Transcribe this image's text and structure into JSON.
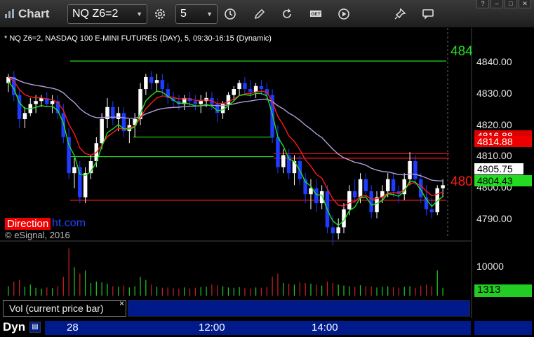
{
  "window": {
    "title": "Chart",
    "symbol": "NQ Z6=2",
    "interval": "5",
    "window_controls": [
      "?",
      "–",
      "□",
      "✕"
    ]
  },
  "toolbar": {
    "buttons": [
      "settings-gear",
      "interval-clock",
      "draw-pencil",
      "refresh",
      "get",
      "play",
      "pin",
      "comment"
    ],
    "get_label": "GET"
  },
  "chart": {
    "description": "* NQ Z6=2, NASDAQ 100 E-MINI FUTURES (DAY), 5, 09:30-16:15 (Dynamic)",
    "watermark_a": "Direction",
    "watermark_b": "ht.com",
    "copyright": "© eSignal, 2016",
    "price_ticks": [
      "4840.00",
      "4830.00",
      "4820.00",
      "4810.00",
      "4800.00",
      "4790.00"
    ],
    "side_labels": {
      "top_green": "484",
      "bottom_red": "480"
    },
    "tags": {
      "red_a": "4816.88",
      "red_b": "4814.88",
      "last": "4805.75",
      "green_hidden": "4804.43"
    },
    "volume_ticks": [
      "10000"
    ],
    "volume_last": "1313",
    "volume_label": "Vol (current price bar)",
    "volume_close": "×",
    "time_labels": [
      "28",
      "12:00",
      "14:00"
    ],
    "dyn_label": "Dyn"
  },
  "colors": {
    "up": "#ffffff",
    "down": "#1d3cff",
    "green_line": "#22dd22",
    "red_line": "#ff1a1a",
    "purple_line": "#b39ddb",
    "vol_green": "#22cc22",
    "vol_red": "#cc2222"
  },
  "chart_data": {
    "type": "candlestick",
    "price_range": [
      4783,
      4852
    ],
    "levels": {
      "green_upper": 4847.3,
      "green_mid1": 4822,
      "green_mid2": 4821,
      "green_lower": 4815.5,
      "red_horizontal": 4801.0,
      "red_upper_a": 4816.5,
      "red_upper_b": 4815.0
    },
    "candles": [
      [
        4840,
        4843,
        4837,
        4842
      ],
      [
        4842,
        4844,
        4834,
        4836
      ],
      [
        4836,
        4838,
        4825,
        4828
      ],
      [
        4828,
        4832,
        4825,
        4830
      ],
      [
        4830,
        4835,
        4829,
        4833
      ],
      [
        4833,
        4836,
        4830,
        4834
      ],
      [
        4834,
        4836,
        4832,
        4835
      ],
      [
        4835,
        4837,
        4832,
        4833
      ],
      [
        4833,
        4836,
        4830,
        4834
      ],
      [
        4834,
        4836,
        4828,
        4830
      ],
      [
        4830,
        4833,
        4820,
        4822
      ],
      [
        4822,
        4825,
        4808,
        4810
      ],
      [
        4810,
        4815,
        4805,
        4812
      ],
      [
        4812,
        4814,
        4800,
        4802
      ],
      [
        4802,
        4812,
        4800,
        4810
      ],
      [
        4810,
        4816,
        4808,
        4814
      ],
      [
        4814,
        4822,
        4812,
        4820
      ],
      [
        4820,
        4830,
        4818,
        4828
      ],
      [
        4828,
        4835,
        4825,
        4832
      ],
      [
        4832,
        4834,
        4826,
        4828
      ],
      [
        4828,
        4832,
        4824,
        4830
      ],
      [
        4830,
        4832,
        4822,
        4824
      ],
      [
        4824,
        4828,
        4820,
        4826
      ],
      [
        4826,
        4830,
        4822,
        4828
      ],
      [
        4828,
        4840,
        4826,
        4838
      ],
      [
        4838,
        4843,
        4836,
        4842
      ],
      [
        4842,
        4844,
        4838,
        4840
      ],
      [
        4840,
        4843,
        4837,
        4841
      ],
      [
        4841,
        4843,
        4836,
        4838
      ],
      [
        4838,
        4840,
        4833,
        4835
      ],
      [
        4835,
        4837,
        4832,
        4834
      ],
      [
        4834,
        4836,
        4831,
        4833
      ],
      [
        4833,
        4836,
        4831,
        4835
      ],
      [
        4835,
        4837,
        4832,
        4834
      ],
      [
        4834,
        4836,
        4831,
        4833
      ],
      [
        4833,
        4836,
        4830,
        4834
      ],
      [
        4834,
        4837,
        4832,
        4835
      ],
      [
        4835,
        4837,
        4831,
        4833
      ],
      [
        4833,
        4835,
        4827,
        4830
      ],
      [
        4830,
        4834,
        4828,
        4833
      ],
      [
        4833,
        4837,
        4831,
        4836
      ],
      [
        4836,
        4839,
        4834,
        4838
      ],
      [
        4838,
        4841,
        4836,
        4840
      ],
      [
        4840,
        4842,
        4836,
        4838
      ],
      [
        4838,
        4841,
        4835,
        4837
      ],
      [
        4837,
        4840,
        4835,
        4839
      ],
      [
        4839,
        4841,
        4836,
        4838
      ],
      [
        4838,
        4840,
        4834,
        4836
      ],
      [
        4836,
        4838,
        4820,
        4822
      ],
      [
        4822,
        4826,
        4810,
        4812
      ],
      [
        4812,
        4818,
        4810,
        4816
      ],
      [
        4816,
        4818,
        4808,
        4810
      ],
      [
        4810,
        4816,
        4806,
        4814
      ],
      [
        4814,
        4816,
        4806,
        4808
      ],
      [
        4808,
        4810,
        4800,
        4803
      ],
      [
        4803,
        4808,
        4798,
        4805
      ],
      [
        4805,
        4808,
        4797,
        4800
      ],
      [
        4800,
        4806,
        4798,
        4804
      ],
      [
        4804,
        4806,
        4790,
        4792
      ],
      [
        4792,
        4796,
        4786,
        4790
      ],
      [
        4790,
        4795,
        4788,
        4792
      ],
      [
        4792,
        4800,
        4790,
        4798
      ],
      [
        4798,
        4806,
        4796,
        4804
      ],
      [
        4804,
        4808,
        4800,
        4802
      ],
      [
        4802,
        4810,
        4800,
        4808
      ],
      [
        4808,
        4810,
        4802,
        4804
      ],
      [
        4804,
        4806,
        4795,
        4797
      ],
      [
        4797,
        4804,
        4795,
        4802
      ],
      [
        4802,
        4806,
        4800,
        4804
      ],
      [
        4804,
        4810,
        4802,
        4808
      ],
      [
        4808,
        4810,
        4802,
        4804
      ],
      [
        4804,
        4806,
        4800,
        4803
      ],
      [
        4803,
        4810,
        4801,
        4808
      ],
      [
        4808,
        4817,
        4806,
        4814
      ],
      [
        4814,
        4816,
        4806,
        4808
      ],
      [
        4808,
        4810,
        4800,
        4802
      ],
      [
        4802,
        4806,
        4796,
        4798
      ],
      [
        4798,
        4802,
        4795,
        4797
      ],
      [
        4797,
        4806,
        4796,
        4805
      ],
      [
        4805,
        4808,
        4802,
        4806
      ]
    ],
    "volume_range": [
      0,
      16000
    ],
    "volume": [
      3000,
      4500,
      5000,
      2800,
      3500,
      2500,
      2200,
      2600,
      2400,
      3000,
      6000,
      15000,
      9000,
      7000,
      8000,
      4000,
      4500,
      4200,
      3800,
      3000,
      2800,
      3200,
      2600,
      3000,
      6000,
      5000,
      3500,
      2800,
      2500,
      2600,
      2400,
      2200,
      2600,
      2300,
      2500,
      2700,
      2800,
      3500,
      3300,
      3000,
      2600,
      2500,
      2700,
      2400,
      2300,
      2600,
      2500,
      2800,
      6000,
      7000,
      4000,
      3800,
      3500,
      4200,
      4000,
      3800,
      3500,
      3200,
      4500,
      4000,
      3500,
      3200,
      3000,
      2800,
      3300,
      3000,
      2900,
      2600,
      2800,
      3000,
      2700,
      2500,
      2800,
      3000,
      2500,
      3200,
      3500,
      3000,
      8000,
      2500
    ]
  }
}
